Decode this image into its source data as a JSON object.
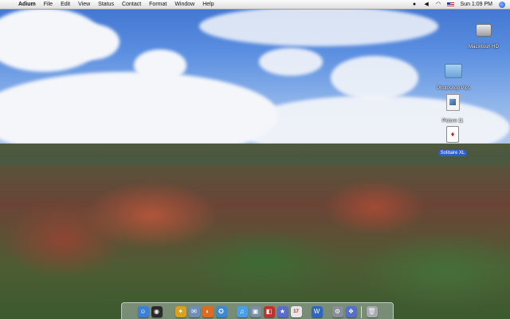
{
  "menubar": {
    "apple_glyph": "",
    "items": [
      "Adium",
      "File",
      "Edit",
      "View",
      "Status",
      "Contact",
      "Format",
      "Window",
      "Help"
    ],
    "clock": "Sun 1:09 PM",
    "status_icons": [
      "adium-duck-icon",
      "volume-icon",
      "wifi-icon",
      "us-flag-icon",
      "spotlight-icon"
    ]
  },
  "desktop": {
    "icons": [
      {
        "name": "macintosh-hd",
        "label": "Macintosh HD",
        "icon": "hard-drive-icon"
      },
      {
        "name": "photoshop-pics",
        "label": "Photoshop Pics",
        "icon": "folder-icon"
      },
      {
        "name": "picture-11",
        "label": "Picture 11",
        "icon": "picture-file-icon"
      },
      {
        "name": "solitaire-xl",
        "label": "Solitaire XL",
        "icon": "playing-card-icon",
        "selected": true
      }
    ]
  },
  "dock": {
    "apps": [
      {
        "name": "finder",
        "icon": "finder-icon",
        "glyph": "☺",
        "color": "#3b7fd8"
      },
      {
        "name": "dashboard",
        "icon": "dashboard-icon",
        "glyph": "◉",
        "color": "#2a2a2a"
      },
      {
        "name": "adium",
        "icon": "adium-icon",
        "glyph": "✦",
        "color": "#d9a21e"
      },
      {
        "name": "mail",
        "icon": "mail-icon",
        "glyph": "✉",
        "color": "#6d8fb8"
      },
      {
        "name": "firefox",
        "icon": "firefox-icon",
        "glyph": "◐",
        "color": "#e06b1f"
      },
      {
        "name": "safari",
        "icon": "safari-icon",
        "glyph": "✪",
        "color": "#3c88d3"
      },
      {
        "name": "itunes",
        "icon": "itunes-icon",
        "glyph": "♫",
        "color": "#4aa0e8"
      },
      {
        "name": "iphoto",
        "icon": "iphoto-icon",
        "glyph": "▣",
        "color": "#7c8ea3"
      },
      {
        "name": "photo-booth",
        "icon": "photo-booth-icon",
        "glyph": "◧",
        "color": "#c4302b"
      },
      {
        "name": "imovie",
        "icon": "imovie-icon",
        "glyph": "★",
        "color": "#5b6cc7"
      },
      {
        "name": "ical",
        "icon": "calendar-icon",
        "glyph": "17",
        "color": "#e7e7e7"
      },
      {
        "name": "word",
        "icon": "word-icon",
        "glyph": "W",
        "color": "#2c67c4"
      },
      {
        "name": "system-preferences",
        "icon": "system-preferences-icon",
        "glyph": "⚙",
        "color": "#8a8e96"
      },
      {
        "name": "preview",
        "icon": "preview-icon",
        "glyph": "❖",
        "color": "#5570c8"
      },
      {
        "name": "trash",
        "icon": "trash-icon",
        "glyph": "🗑",
        "color": "#a8acb2"
      }
    ]
  }
}
